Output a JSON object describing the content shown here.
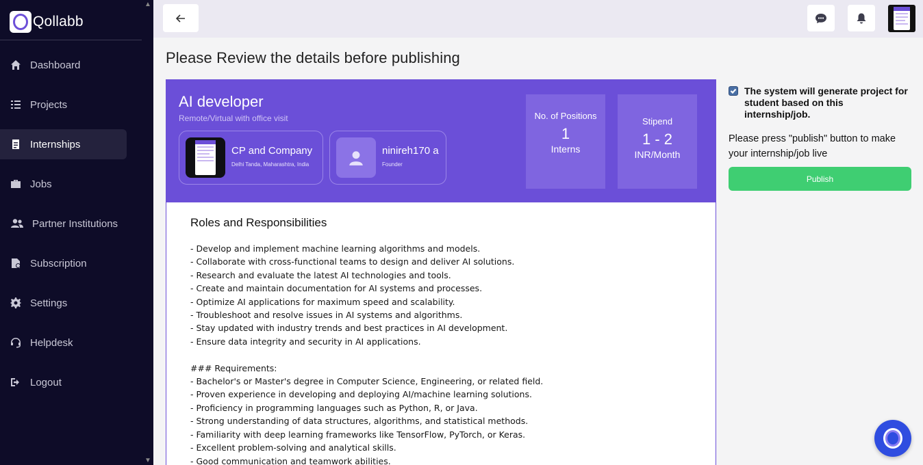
{
  "app": {
    "name": "Qollabb"
  },
  "sidebar": {
    "items": [
      {
        "label": "Dashboard",
        "icon": "home-icon"
      },
      {
        "label": "Projects",
        "icon": "list-icon"
      },
      {
        "label": "Internships",
        "icon": "clipboard-icon",
        "active": true
      },
      {
        "label": "Jobs",
        "icon": "briefcase-icon"
      },
      {
        "label": "Partner Institutions",
        "icon": "users-icon"
      },
      {
        "label": "Subscription",
        "icon": "file-dollar-icon"
      },
      {
        "label": "Settings",
        "icon": "gear-icon"
      },
      {
        "label": "Helpdesk",
        "icon": "headset-icon"
      },
      {
        "label": "Logout",
        "icon": "logout-icon"
      }
    ]
  },
  "page": {
    "title": "Please Review the details before publishing"
  },
  "job": {
    "title": "AI developer",
    "mode": "Remote/Virtual with office visit",
    "company": {
      "name": "CP and Company",
      "location": "Delhi Tanda, Maharashtra, India"
    },
    "founder": {
      "name": "ninireh170 a",
      "role": "Founder"
    },
    "positions": {
      "label": "No. of Positions",
      "value": "1",
      "unit": "Interns"
    },
    "stipend": {
      "label": "Stipend",
      "value": "1 - 2",
      "unit": "INR/Month"
    }
  },
  "details": {
    "section_title": "Roles and Responsibilities",
    "text": "- Develop and implement machine learning algorithms and models.\n- Collaborate with cross-functional teams to design and deliver AI solutions.\n- Research and evaluate the latest AI technologies and tools.\n- Create and maintain documentation for AI systems and processes.\n- Optimize AI applications for maximum speed and scalability.\n- Troubleshoot and resolve issues in AI systems and algorithms.\n- Stay updated with industry trends and best practices in AI development.\n- Ensure data integrity and security in AI applications.\n\n### Requirements:\n- Bachelor's or Master's degree in Computer Science, Engineering, or related field.\n- Proven experience in developing and deploying AI/machine learning solutions.\n- Proficiency in programming languages such as Python, R, or Java.\n- Strong understanding of data structures, algorithms, and statistical methods.\n- Familiarity with deep learning frameworks like TensorFlow, PyTorch, or Keras.\n- Excellent problem-solving and analytical skills.\n- Good communication and teamwork abilities."
  },
  "publish_panel": {
    "checkbox_checked": true,
    "checkbox_text": "The system will generate project for student based on this internship/job.",
    "instruction": "Please press \"publish\" button to make your internship/job live",
    "button_label": "Publish"
  },
  "colors": {
    "sidebar": "#0e0c28",
    "accent": "#6b4fd8",
    "publish": "#3fce72",
    "chat": "#2f4de0"
  }
}
